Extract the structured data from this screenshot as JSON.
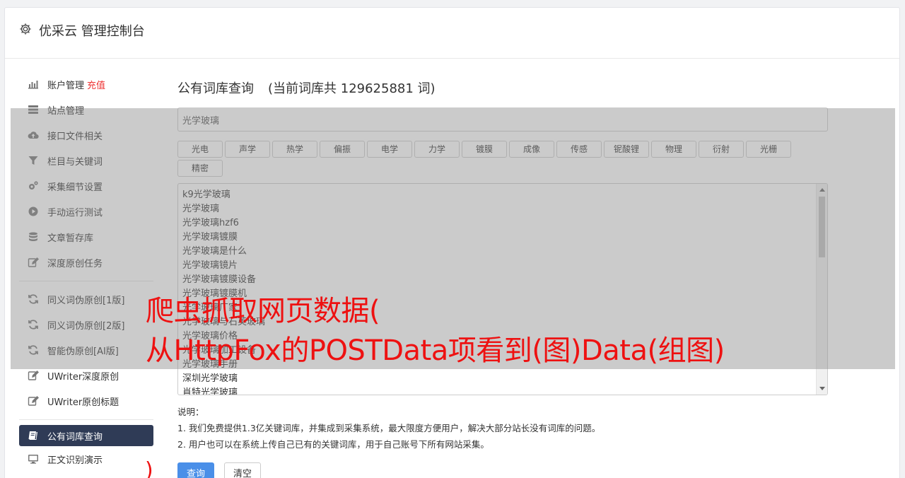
{
  "app": {
    "title": "优采云 管理控制台",
    "icon": "gear-icon"
  },
  "sidebar": {
    "group1": [
      {
        "label": "账户管理",
        "extra": "充值",
        "icon": "bar-chart-icon"
      },
      {
        "label": "站点管理",
        "icon": "server-icon"
      },
      {
        "label": "接口文件相关",
        "icon": "cloud-upload-icon"
      },
      {
        "label": "栏目与关键词",
        "icon": "filter-icon"
      },
      {
        "label": "采集细节设置",
        "icon": "gears-icon"
      },
      {
        "label": "手动运行测试",
        "icon": "play-circle-icon"
      },
      {
        "label": "文章暂存库",
        "icon": "database-icon"
      },
      {
        "label": "深度原创任务",
        "icon": "edit-icon"
      }
    ],
    "group2": [
      {
        "label": "同义词伪原创[1版]",
        "icon": "refresh-icon"
      },
      {
        "label": "同义词伪原创[2版]",
        "icon": "refresh-icon"
      },
      {
        "label": "智能伪原创[AI版]",
        "icon": "refresh-icon"
      },
      {
        "label": "UWriter深度原创",
        "icon": "edit-icon"
      },
      {
        "label": "UWriter原创标题",
        "icon": "edit-icon"
      }
    ],
    "group3": [
      {
        "label": "公有词库查询",
        "icon": "book-icon",
        "active": true
      },
      {
        "label": "正文识别演示",
        "icon": "monitor-icon"
      }
    ]
  },
  "main": {
    "heading": "公有词库查询",
    "count_text": "(当前词库共 129625881 词)",
    "search_value": "光学玻璃",
    "tags": [
      "光电",
      "声学",
      "热学",
      "偏振",
      "电学",
      "力学",
      "镀膜",
      "成像",
      "传感",
      "铌酸锂",
      "物理",
      "衍射",
      "光栅",
      "精密"
    ],
    "results": [
      "k9光学玻璃",
      "光学玻璃",
      "光学玻璃hzf6",
      "光学玻璃镀膜",
      "光学玻璃是什么",
      "光学玻璃镜片",
      "光学玻璃镀膜设备",
      "光学玻璃镀膜机",
      "光学玻璃厂家",
      "光学玻璃与石英玻璃",
      "光学玻璃价格",
      "光学玻璃加工设备",
      "光学玻璃手册",
      "深圳光学玻璃",
      "肖特光学玻璃"
    ],
    "notes_title": "说明：",
    "notes": [
      "1. 我们免费提供1.3亿关键词库，并集成到采集系统，最大限度方便用户，解决大部分站长没有词库的问题。",
      "2. 用户也可以在系统上传自己已有的关键词库，用于自己账号下所有网站采集。"
    ],
    "query_button": "查询",
    "clear_button": "清空"
  },
  "overlay": {
    "line1": "爬虫抓取网页数据(",
    "line2": "从HttpFox的POSTData项看到(图)Data(组图)",
    "paren": ")"
  },
  "colors": {
    "active_bg": "#2f3b56",
    "primary": "#4a8fe8",
    "overlay_text": "#ee1111",
    "recharge": "#ee3333"
  }
}
